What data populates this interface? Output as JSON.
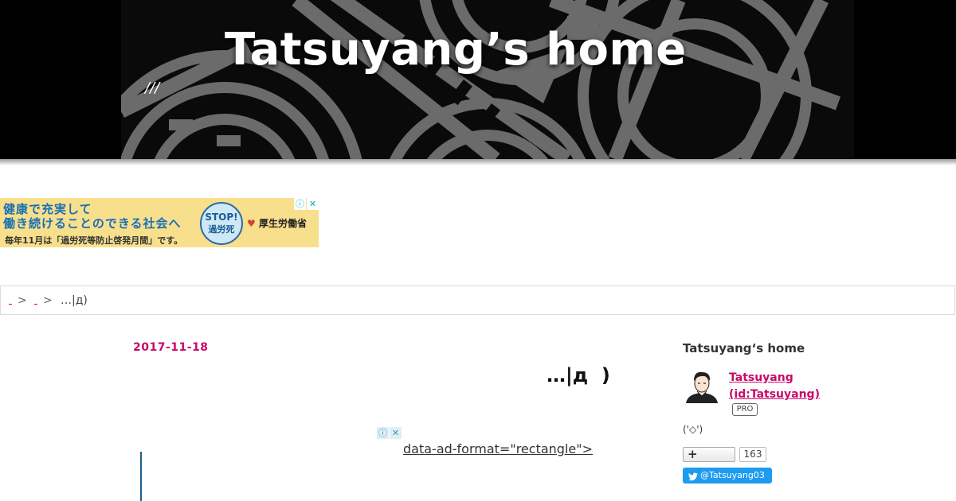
{
  "header": {
    "title": "Tatsuyang’s home",
    "description": "///"
  },
  "ad_banner": {
    "line1": "健康で充実して",
    "line2": "働き続けることのできる社会へ",
    "line3": "毎年11月は「過労死等防止啓発月間」です。",
    "badge_top": "STOP!",
    "badge_bottom": "過労死",
    "ministry": "厚生労働省",
    "info_icon": "ⓘ",
    "close_icon": "✕"
  },
  "breadcrumb": {
    "items": [
      "",
      ""
    ],
    "separator": ">",
    "current": "…|д)"
  },
  "entry": {
    "date": "2017-11-18",
    "title": "…|д  )",
    "leaked_text": "data-ad-format=\"rectangle\">"
  },
  "sidebar": {
    "title": "Tatsuyang‘s home",
    "profile_name_line1": "Tatsuyang",
    "profile_name_line2": "(id:Tatsuyang)",
    "pro_badge": "PRO",
    "description": "('◇')",
    "subscribe_count": "163",
    "twitter_handle": "@Tatsuyang03"
  },
  "colors": {
    "accent": "#c70a6a",
    "header_bg": "#000000",
    "twitter": "#1d9bf0",
    "ad_background": "#f7df8c"
  }
}
